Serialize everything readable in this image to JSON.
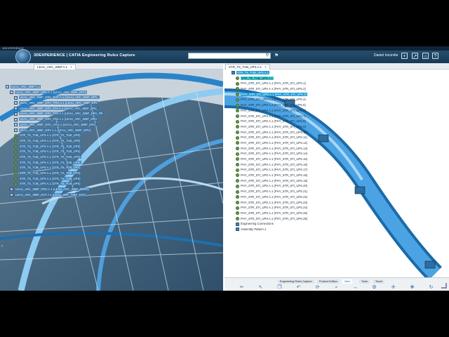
{
  "window": {
    "title_strip": "3DEXPERIENCE",
    "brand_prefix": "3DEXPERIENCE | CATIA",
    "app_name": "Engineering Rules Capture",
    "search": {
      "value": "",
      "placeholder": ""
    },
    "user_name": "Daniel Incorvite"
  },
  "left_tab": {
    "label": "LEAU_ARC_WBP A.1"
  },
  "right_tab": {
    "label": "STR_TS_TUB_UPS A.1"
  },
  "left_tree": [
    "LEAU_ARC_WBP A.1",
    "LEAU_ARC_WBP_DRV A.1 (LEAU_ARC_WBP_DRV)",
    "LEAU_ARC_WBP_DRV_SUP A.1 (LEAU_ARC_WBP_DRV_",
    "LEAU_ARC_WBP_DRV_PRO A.1 (LEAU_ARC_WBP_DRV",
    "LEAU_ARC_WBP_DRV_STA A.1 (LEAU_ARC_WBP_DRV_",
    "LEAU_ARC_WBP_DRV_PR1 A.1 (LEAU_ARC_WBP_DRV_PR",
    "LEAU_ARC_WBP_DRV_FR2 A.1 (LEAU_ARC_WBP_DRV",
    "LEAU_ARC_WBP_DRV_AR A.1 (LEAU_ARC_WBP_DRV_",
    "LEAU_ARC_WBP_DRV A.1 (LEAU_ARC_WBP_DRV)",
    "STR_TS_TUB_UPS A.1 (STR_TS_TUB_UPS)",
    "STR_TS_TUB_UPS A.1 (STR_TS_TUB_UPS)",
    "STR_TS_TUB_UPS A.1 (STR_TS_TUB_UPS)",
    "STR_TS_TUB_UPS A.1 (STR_TS_TUB_UPS)",
    "STR_TS_TUB_UPS A.1 (STR_TS_TUB_UPS)",
    "STR_TS_TUB_UPS A.1 (STR_TS_TUB_UPS)",
    "STR_TS_TUB_UPS A.1 (STR_TS_TUB_UPS)",
    "STR_TS_TUB_UPS A.1 (STR_TS_TUB_UPS)",
    "STR_TS_TUB_UPS A.1 (STR_TS_TUB_UPS)",
    "STR_TS_TUB_UPS A.1 (STR_TS_TUB_UPS)",
    "LEAU_ARC_WBP_PRO A.1 (LEAU_ARC_WBP_PROD)",
    "LEAU_ARC_WBP_RST A.1 (LEAU_ARC_WBP_RST)"
  ],
  "right_tree": {
    "root": "STR_TS_TUB_UPS A.1",
    "top_items": [
      "STR_TS_TUB_UPS A.1",
      "PHY_STR_STI_UPS A.1 (PHY_STR_STI_UPS.1)",
      "PHY_STR_STI_UPS A.1 (PHY_STR_STI_UPS.2)",
      "PHY_STR_STI_UPS A.1 (PHY_STR_STI_UPS.3)"
    ],
    "items": [
      "PHY_STR_STI_UPS A.1 (PHY_STR_STI_UPS.4)",
      "PHY_STR_STI_UPS A.1 (PHY_STR_STI_UPS.5)",
      "PHY_STR_STI_UPS A.1 (PHY_STR_STI_UPS.6)",
      "PHY_STR_STI_UPS A.1 (PHY_STR_STI_UPS.7)",
      "PHY_STR_STI_UPS A.1 (PHY_STR_STI_UPS.8)",
      "PHY_STR_STI_UPS A.1 (PHY_STR_STI_UPS.9)",
      "PHY_STR_STI_UPS A.1 (PHY_STR_STI_UPS.10)",
      "PHY_STR_STI_UPS A.1 (PHY_STR_STI_UPS.11)",
      "PHY_STR_STI_UPS A.1 (PHY_STR_STI_UPS.12)",
      "PHY_STR_STI_UPS A.1 (PHY_STR_STI_UPS.13)",
      "PHY_STR_STI_UPS A.1 (PHY_STR_STI_UPS.14)",
      "PHY_STR_STI_UPS A.1 (PHY_STR_STI_UPS.15)",
      "PHY_STR_STI_UPS A.1 (PHY_STR_STI_UPS.16)",
      "PHY_STR_STI_UPS A.1 (PHY_STR_STI_UPS.17)",
      "PHY_STR_STI_UPS A.1 (PHY_STR_STI_UPS.18)",
      "PHY_STR_STI_UPS A.1 (PHY_STR_STI_UPS.19)",
      "PHY_STR_STI_UPS A.1 (PHY_STR_STI_UPS.20)",
      "PHY_STR_STI_UPS A.1 (PHY_STR_STI_UPS.21)",
      "PHY_STR_STI_UPS A.1 (PHY_STR_STI_UPS.22)",
      "PHY_STR_STI_UPS A.1 (PHY_STR_STI_UPS.23)",
      "PHY_STR_STI_UPS A.1 (PHY_STR_STI_UPS.24)",
      "PHY_STR_STI_UPS A.1 (PHY_STR_STI_UPS.25)",
      "PHY_STR_STI_UPS A.1 (PHY_STR_STI_UPS.26)"
    ],
    "footer_items": [
      "Engineering Connections",
      "Assembly Pattern.1"
    ]
  },
  "bottom_tabs": [
    "Engineering Rules Capture",
    "Product Edition",
    "View",
    "Tools",
    "Touch"
  ],
  "bottom_active_tab": "View",
  "bottom_icons": [
    "scissors-icon",
    "cursor-icon",
    "copy-icon",
    "undo-icon",
    "refresh-icon",
    "zoom-icon",
    "measure-icon",
    "gear-icon",
    "compass-icon",
    "pan-icon",
    "rotate-icon"
  ],
  "colors": {
    "topbar": "#1f4868",
    "highlight": "#1e9bd7",
    "highlight_teal": "#3fd1c9",
    "model_blue": "#3a8fd0"
  }
}
